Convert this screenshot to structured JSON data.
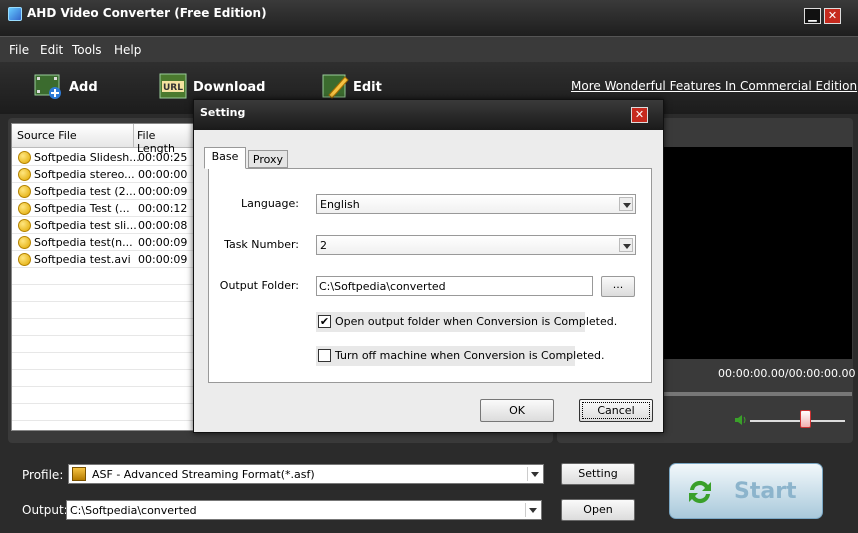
{
  "window": {
    "title": "AHD Video Converter (Free Edition)",
    "minimize": "▁",
    "close": "✕"
  },
  "menu": [
    "File",
    "Edit",
    "Tools",
    "Help"
  ],
  "toolbar": {
    "add_label": "Add",
    "download_label": "Download",
    "edit_label": "Edit",
    "commercial_link": "More Wonderful Features In Commercial Edition"
  },
  "file_list": {
    "columns": [
      "Source File",
      "File Length"
    ],
    "rows": [
      {
        "name": "Softpedia Slidesh...",
        "length": "00:00:25"
      },
      {
        "name": "Softpedia stereo...",
        "length": "00:00:00"
      },
      {
        "name": "Softpedia test (2...",
        "length": "00:00:09"
      },
      {
        "name": "Softpedia Test (...",
        "length": "00:00:12"
      },
      {
        "name": "Softpedia test sli...",
        "length": "00:00:08"
      },
      {
        "name": "Softpedia test(n...",
        "length": "00:00:09"
      },
      {
        "name": "Softpedia test.avi",
        "length": "00:00:09"
      }
    ]
  },
  "preview": {
    "time": "00:00:00.00/00:00:00.00"
  },
  "bottom": {
    "profile_label": "Profile:",
    "profile_value": "ASF - Advanced Streaming Format(*.asf)",
    "setting_button": "Setting",
    "output_label": "Output:",
    "output_value": "C:\\Softpedia\\converted",
    "open_button": "Open",
    "start_label": "Start"
  },
  "dialog": {
    "title": "Setting",
    "close": "✕",
    "tabs": [
      "Base",
      "Proxy"
    ],
    "language_label": "Language:",
    "language_value": "English",
    "task_label": "Task Number:",
    "task_value": "2",
    "folder_label": "Output Folder:",
    "folder_value": "C:\\Softpedia\\converted",
    "browse_label": "...",
    "open_folder_label": "Open output folder when Conversion  is Completed.",
    "open_folder_checked": "✔",
    "turn_off_label": "Turn off machine when Conversion  is Completed.",
    "ok_label": "OK",
    "cancel_label": "Cancel"
  },
  "colors": {
    "accent_green": "#3aa02a",
    "close_red": "#c62a1e",
    "start_blue": "#8cb4cc"
  }
}
